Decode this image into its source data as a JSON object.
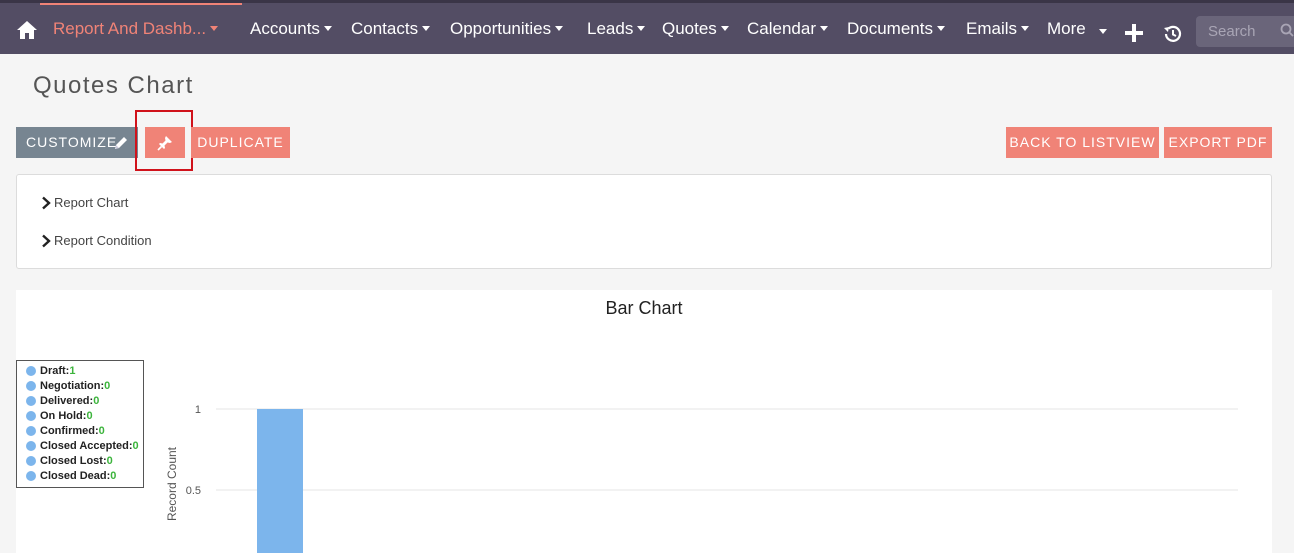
{
  "nav": {
    "items": [
      {
        "label": "Report And Dashb...",
        "active": true
      },
      {
        "label": "Accounts"
      },
      {
        "label": "Contacts"
      },
      {
        "label": "Opportunities"
      },
      {
        "label": "Leads"
      },
      {
        "label": "Quotes"
      },
      {
        "label": "Calendar"
      },
      {
        "label": "Documents"
      },
      {
        "label": "Emails"
      },
      {
        "label": "More"
      }
    ],
    "search_placeholder": "Search"
  },
  "page": {
    "title": "Quotes Chart"
  },
  "actions": {
    "customize_label": "CUSTOMIZE",
    "duplicate_label": "DUPLICATE",
    "back_label": "BACK TO LISTVIEW",
    "export_label": "EXPORT PDF"
  },
  "panel": {
    "report_chart": "Report Chart",
    "report_condition": "Report Condition"
  },
  "legend": [
    {
      "label": "Draft:",
      "value": "1"
    },
    {
      "label": "Negotiation:",
      "value": "0"
    },
    {
      "label": "Delivered:",
      "value": "0"
    },
    {
      "label": "On Hold:",
      "value": "0"
    },
    {
      "label": "Confirmed:",
      "value": "0"
    },
    {
      "label": "Closed Accepted:",
      "value": "0"
    },
    {
      "label": "Closed Lost:",
      "value": "0"
    },
    {
      "label": "Closed Dead:",
      "value": "0"
    }
  ],
  "colors": {
    "nav_bg": "#534d64",
    "accent": "#f08377",
    "customize_bg": "#778591",
    "bar": "#7cb5ec",
    "legend_value": "#3cb43c"
  },
  "chart_data": {
    "type": "bar",
    "title": "Bar Chart",
    "ylabel": "Record Count",
    "categories": [
      "Draft",
      "Negotiation",
      "Delivered",
      "On Hold",
      "Confirmed",
      "Closed Accepted",
      "Closed Lost",
      "Closed Dead"
    ],
    "values": [
      1,
      0,
      0,
      0,
      0,
      0,
      0,
      0
    ],
    "yticks": [
      "1",
      "0.5"
    ],
    "ylim": [
      0,
      1
    ],
    "grid": true,
    "legend": "left"
  }
}
